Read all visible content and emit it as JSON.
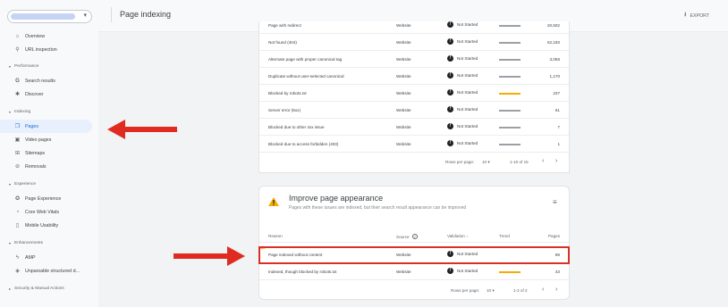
{
  "sidebar": {
    "items": [
      {
        "label": "Overview",
        "icon": "home-icon"
      },
      {
        "label": "URL inspection",
        "icon": "search-icon"
      },
      {
        "label": "Search results",
        "icon": "google-g-icon"
      },
      {
        "label": "Discover",
        "icon": "asterisk-icon"
      },
      {
        "label": "Pages",
        "icon": "pages-icon",
        "active": true
      },
      {
        "label": "Video pages",
        "icon": "video-pages-icon"
      },
      {
        "label": "Sitemaps",
        "icon": "sitemap-icon"
      },
      {
        "label": "Removals",
        "icon": "removals-icon"
      },
      {
        "label": "Page Experience",
        "icon": "page-experience-icon"
      },
      {
        "label": "Core Web Vitals",
        "icon": "gauge-icon"
      },
      {
        "label": "Mobile Usability",
        "icon": "phone-icon"
      },
      {
        "label": "AMP",
        "icon": "bolt-icon"
      },
      {
        "label": "Unparsable structured d...",
        "icon": "structured-data-icon"
      }
    ],
    "sections": [
      "Performance",
      "Indexing",
      "Experience",
      "Enhancements",
      "Security & Manual Actions"
    ]
  },
  "header": {
    "title": "Page indexing",
    "export_label": "EXPORT"
  },
  "table1": {
    "rows": [
      {
        "reason": "Page with redirect",
        "source": "Website",
        "validation": "Not Started",
        "pages": "20,502"
      },
      {
        "reason": "Not found (404)",
        "source": "Website",
        "validation": "Not Started",
        "pages": "52,193"
      },
      {
        "reason": "Alternate page with proper canonical tag",
        "source": "Website",
        "validation": "Not Started",
        "pages": "3,056"
      },
      {
        "reason": "Duplicate without user-selected canonical",
        "source": "Website",
        "validation": "Not Started",
        "pages": "1,170"
      },
      {
        "reason": "Blocked by robots.txt",
        "source": "Website",
        "validation": "Not Started",
        "pages": "237"
      },
      {
        "reason": "Server error (5xx)",
        "source": "Website",
        "validation": "Not Started",
        "pages": "61"
      },
      {
        "reason": "Blocked due to other 4xx issue",
        "source": "Website",
        "validation": "Not Started",
        "pages": "7"
      },
      {
        "reason": "Blocked due to access forbidden (403)",
        "source": "Website",
        "validation": "Not Started",
        "pages": "1"
      }
    ],
    "pager": {
      "rows_per_page_label": "Rows per page:",
      "rows_per_page": "10",
      "range": "1-10 of 15"
    }
  },
  "card2": {
    "title": "Improve page appearance",
    "description": "Pages with these issues are indexed, but their search result appearance can be improved",
    "headers": {
      "reason": "Reason",
      "source": "Source",
      "validation": "Validation",
      "trend": "Trend",
      "pages": "Pages"
    },
    "rows": [
      {
        "reason": "Page indexed without content",
        "source": "Website",
        "validation": "Not Started",
        "pages": "89"
      },
      {
        "reason": "Indexed, though blocked by robots.txt",
        "source": "Website",
        "validation": "Not Started",
        "pages": "43"
      }
    ],
    "pager": {
      "rows_per_page_label": "Rows per page:",
      "rows_per_page": "10",
      "range": "1-2 of 2"
    }
  },
  "colors": {
    "accent": "#1967d2",
    "highlight": "#d93025",
    "trend_gray": "#9aa0a6",
    "trend_orange": "#f9ab00",
    "warning": "#f9ab00"
  }
}
